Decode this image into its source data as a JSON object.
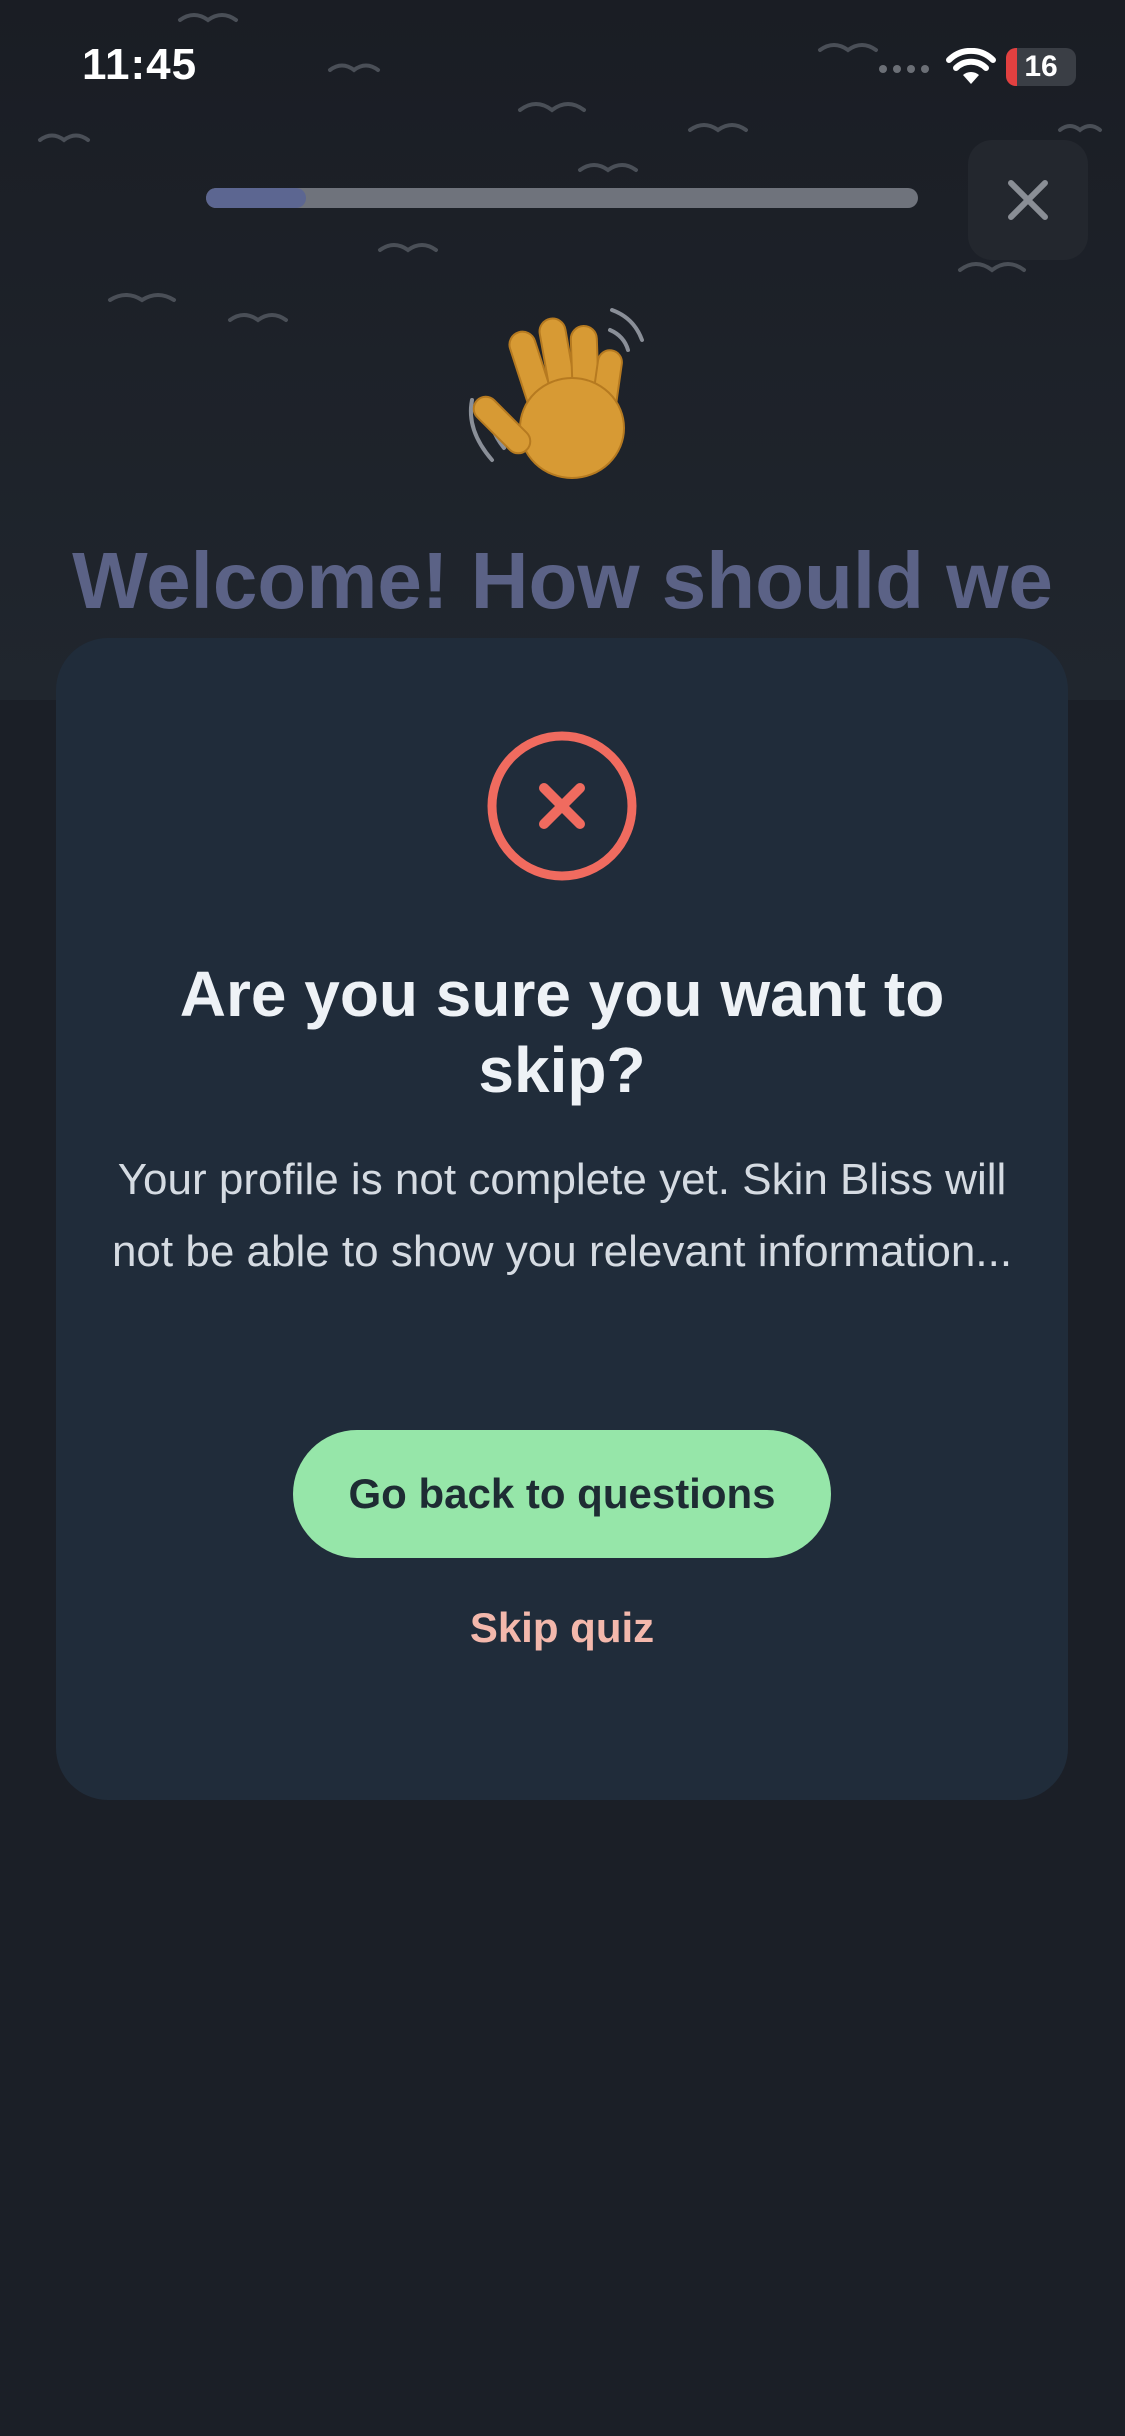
{
  "status_bar": {
    "time": "11:45",
    "battery_level": "16",
    "signal_icon": "signal-bars-icon",
    "wifi_icon": "wifi-icon"
  },
  "progress": {
    "value": 0.14
  },
  "header": {
    "close_icon": "close-icon"
  },
  "background": {
    "emoji_icon": "waving-hand-icon",
    "title": "Welcome! How should we"
  },
  "modal": {
    "icon": "error-x-circle-icon",
    "title": "Are you sure you want to skip?",
    "message": "Your profile is not complete yet. Skin Bliss will not be able to show you relevant information...",
    "primary_label": "Go back to questions",
    "secondary_label": "Skip quiz"
  },
  "colors": {
    "background": "#1b1f27",
    "modal": "#202c3a",
    "primary_button": "#96e6a9",
    "danger": "#f06b5f",
    "link": "#f3b8ac",
    "progress_fill": "#5c6691"
  }
}
